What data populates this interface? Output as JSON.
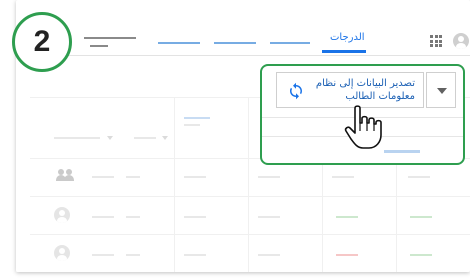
{
  "step": {
    "number": "2"
  },
  "header": {
    "grades_tab_label": "الدرجات"
  },
  "menu": {
    "export_label": "تصدير البيانات إلى نظام معلومات الطالب"
  },
  "icons": {
    "apps": "apps-grid-icon",
    "account": "account-avatar-icon",
    "refresh": "sync-icon",
    "dropdown": "arrow-drop-down-icon",
    "cursor": "hand-pointer-icon",
    "class": "people-icon"
  },
  "colors": {
    "highlight": "#2e9e4f",
    "accent": "#1a73e8",
    "link": "#1a5fb4"
  }
}
